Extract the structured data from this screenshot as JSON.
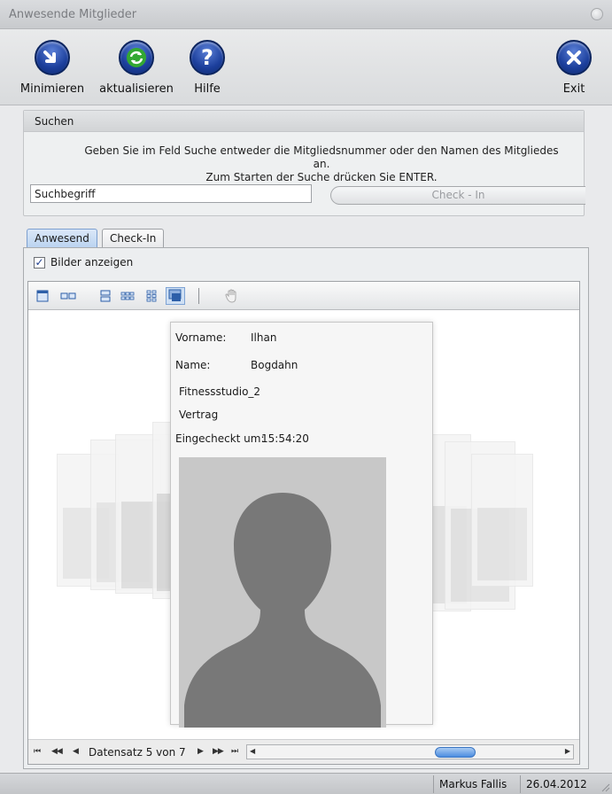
{
  "window": {
    "title": "Anwesende Mitglieder"
  },
  "toolbar": {
    "minimize": {
      "label": "Minimieren",
      "icon": "arrow-down-right-icon"
    },
    "refresh": {
      "label": "aktualisieren",
      "icon": "refresh-icon"
    },
    "help": {
      "label": "Hilfe",
      "icon": "question-icon"
    },
    "exit": {
      "label": "Exit",
      "icon": "close-icon"
    }
  },
  "search": {
    "header": "Suchen",
    "hint_line1": "Geben Sie im Feld Suche entweder die Mitgliedsnummer oder den Namen des Mitgliedes an.",
    "hint_line2": "Zum Starten der Suche drücken Sie ENTER.",
    "input_value": "Suchbegriff",
    "checkin_label": "Check - In"
  },
  "tabs": [
    {
      "label": "Anwesend",
      "active": true
    },
    {
      "label": "Check-In",
      "active": false
    }
  ],
  "show_images": {
    "label": "Bilder anzeigen",
    "checked": true
  },
  "card": {
    "vorname_label": "Vorname:",
    "vorname_value": "Ilhan",
    "name_label": "Name:",
    "name_value": "Bogdahn",
    "studio": "Fitnessstudio_2",
    "contract": "Vertrag",
    "checkin_label": "Eingecheckt um:",
    "checkin_time": "15:54:20"
  },
  "navigator": {
    "record_text": "Datensatz 5 von 7"
  },
  "status": {
    "user": "Markus Fallis",
    "date": "26.04.2012"
  },
  "colors": {
    "accent_blue": "#1c3f9c",
    "refresh_green": "#2e9a2e",
    "exit_blue": "#1c3f9c",
    "silhouette": "#777777"
  }
}
